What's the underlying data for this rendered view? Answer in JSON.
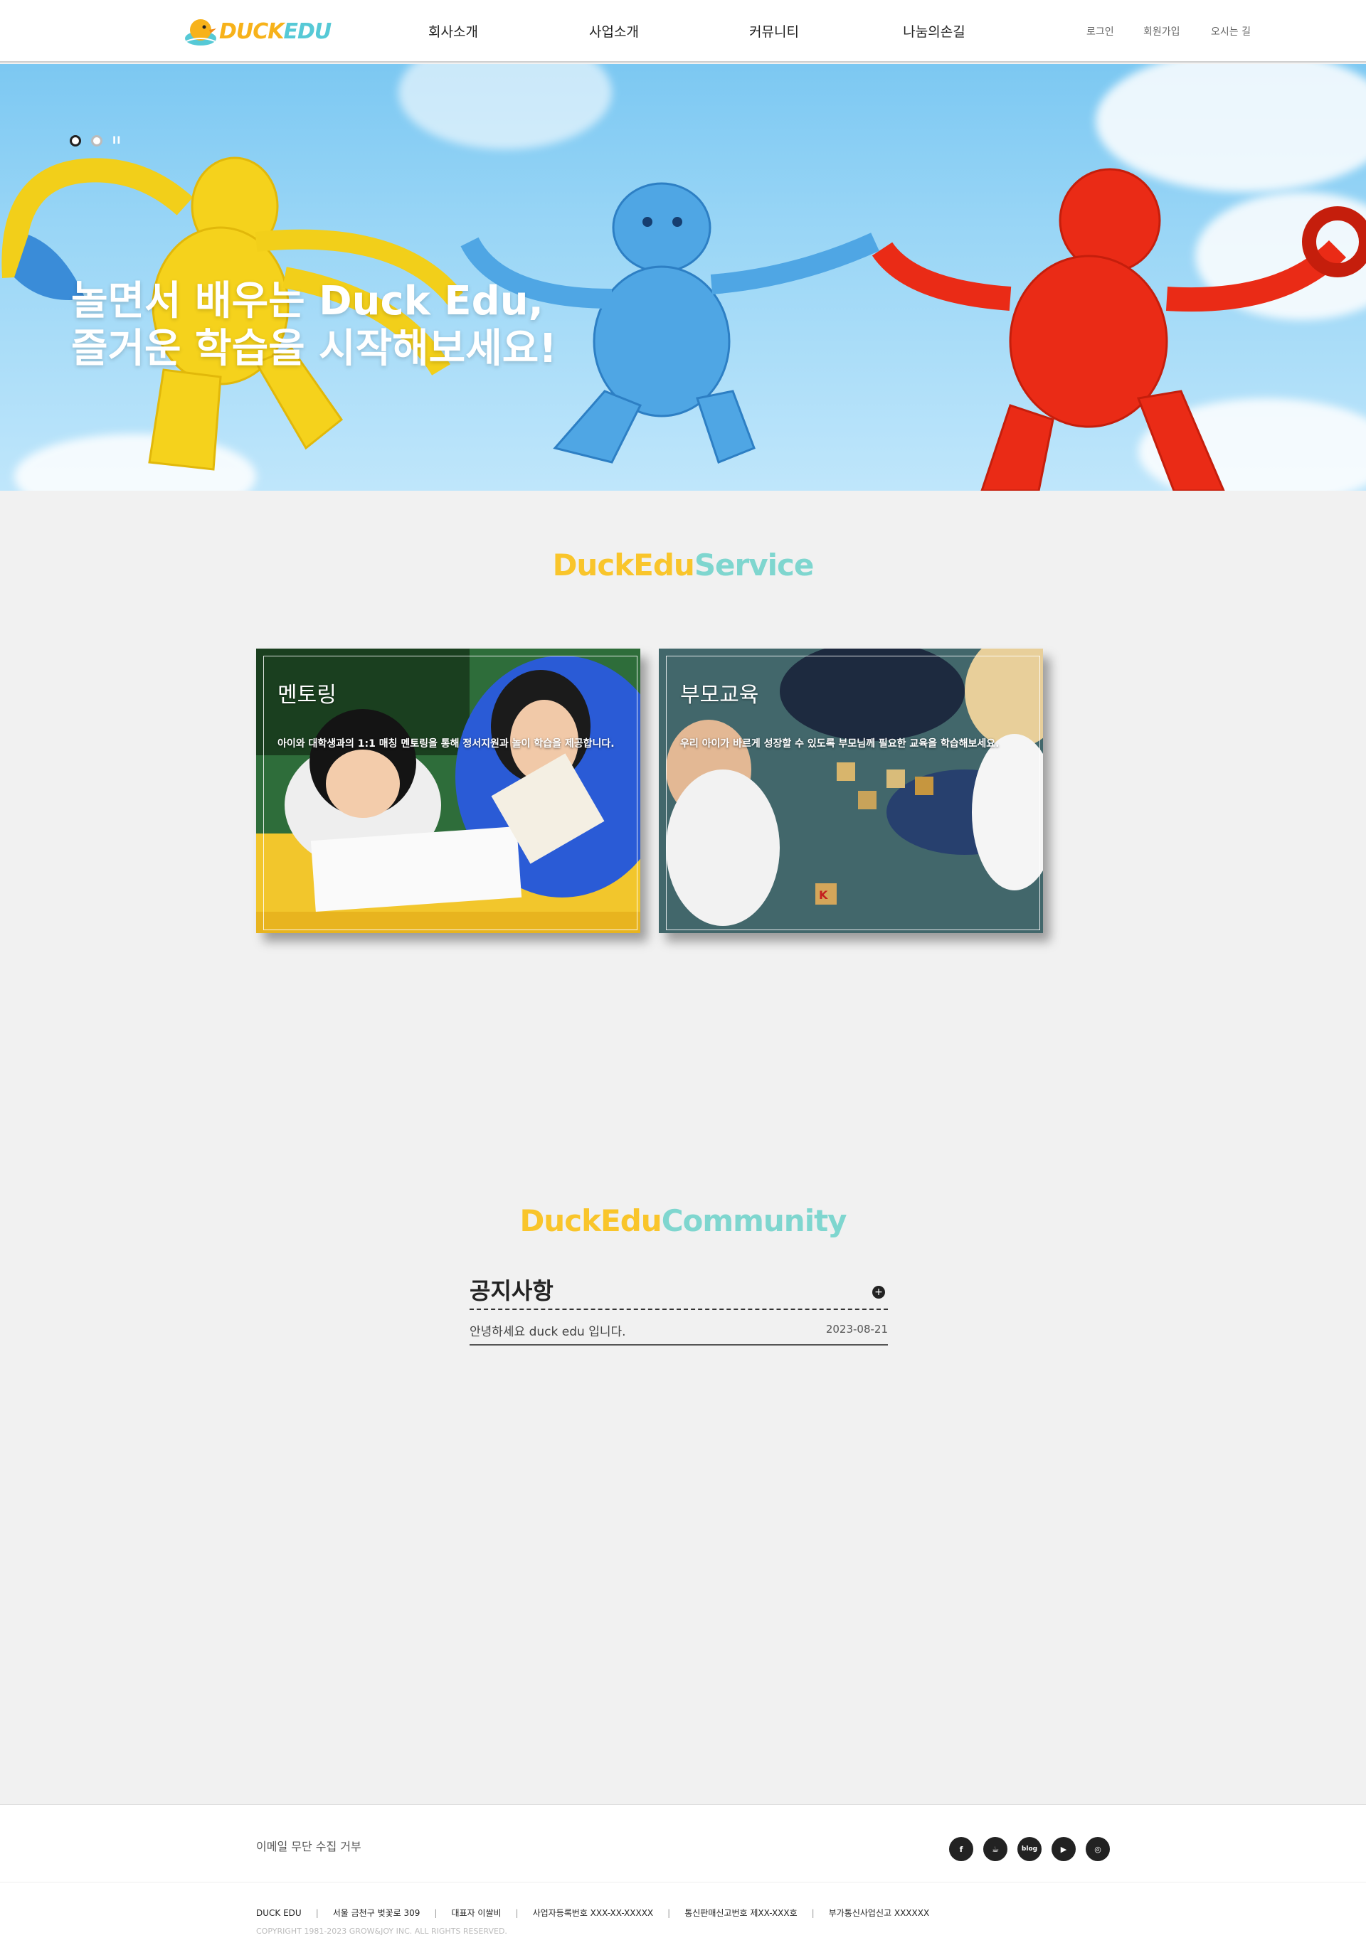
{
  "header": {
    "logo": {
      "part1": "DUCK",
      "part2": "EDU"
    },
    "nav": [
      "회사소개",
      "사업소개",
      "커뮤니티",
      "나눔의손길"
    ],
    "util": {
      "login": "로그인",
      "signup": "회원가입",
      "directions": "오시는 길"
    }
  },
  "hero": {
    "title_line1": "놀면서 배우는 Duck Edu,",
    "title_line2": "즐거운 학습을 시작해보세요!",
    "pause_label": "II"
  },
  "service": {
    "title_part1": "DuckEdu",
    "title_part2": "Service",
    "cards": [
      {
        "title": "멘토링",
        "desc": "아이와 대학생과의 1:1 매칭 멘토링을 통해 정서지원과 놀이 학습을 제공합니다."
      },
      {
        "title": "부모교육",
        "desc": "우리 아이가 바르게 성장할 수 있도록 부모님께 필요한 교육을 학습해보세요."
      }
    ]
  },
  "community": {
    "title_part1": "DuckEdu",
    "title_part2": "Community",
    "notice_title": "공지사항",
    "more_label": "+",
    "posts": [
      {
        "text": "안녕하세요 duck edu 입니다.",
        "date": "2023-08-21"
      }
    ]
  },
  "footer": {
    "email_refuse": "이메일 무단 수집 거부",
    "socials": [
      {
        "icon": "facebook-icon",
        "glyph": "f"
      },
      {
        "icon": "kakao-story-icon",
        "glyph": "☕"
      },
      {
        "icon": "blog-icon",
        "glyph": "blog"
      },
      {
        "icon": "youtube-icon",
        "glyph": "▶"
      },
      {
        "icon": "instagram-icon",
        "glyph": "◎"
      }
    ],
    "info": [
      "DUCK EDU",
      "서울 금천구 벚꽃로 309",
      "대표자 이쌀비",
      "사업자등록번호 XXX-XX-XXXXX",
      "통신판매신고번호 제XX-XXX호",
      "부가통신사업신고 XXXXXX"
    ],
    "copyright": "COPYRIGHT 1981-2023 GROW&JOY INC. ALL RIGHTS RESERVED."
  },
  "colors": {
    "yellow": "#f9c52b",
    "mint": "#7fd6cf",
    "sky": "#8fd0f4"
  }
}
